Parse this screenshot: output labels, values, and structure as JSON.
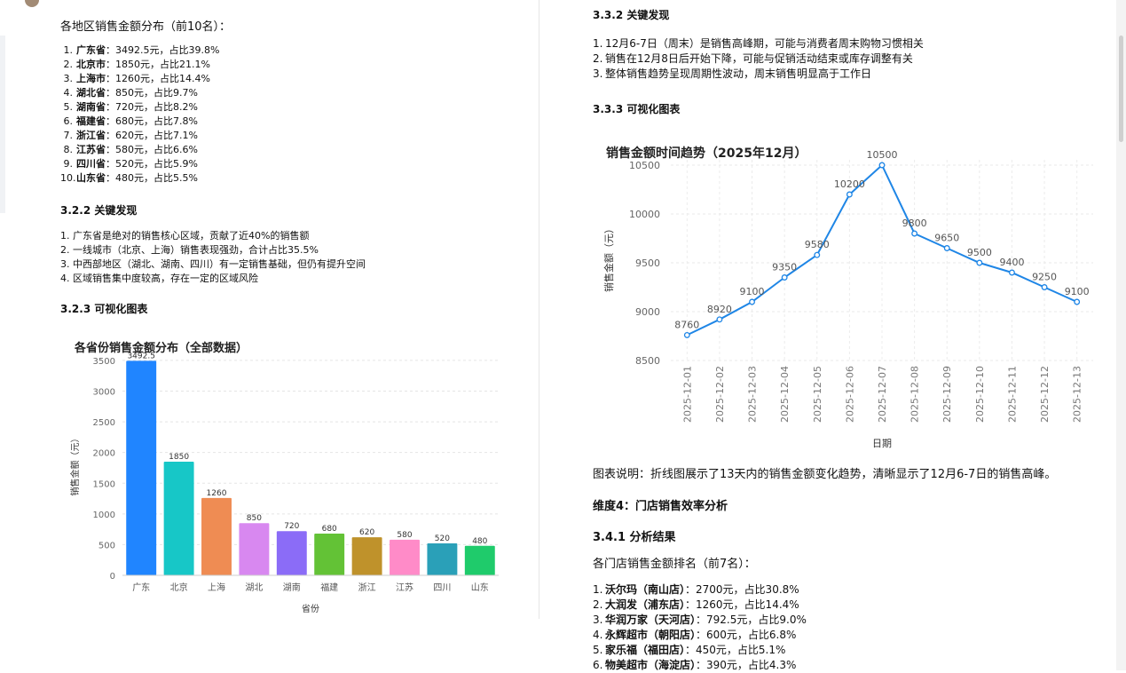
{
  "left": {
    "intro": "各地区销售金额分布（前10名）：",
    "region_list": [
      {
        "num": "1.",
        "name": "广东省",
        "detail": "：3492.5元，占比39.8%"
      },
      {
        "num": "2.",
        "name": "北京市",
        "detail": "：1850元，占比21.1%"
      },
      {
        "num": "3.",
        "name": "上海市",
        "detail": "：1260元，占比14.4%"
      },
      {
        "num": "4.",
        "name": "湖北省",
        "detail": "：850元，占比9.7%"
      },
      {
        "num": "5.",
        "name": "湖南省",
        "detail": "：720元，占比8.2%"
      },
      {
        "num": "6.",
        "name": "福建省",
        "detail": "：680元，占比7.8%"
      },
      {
        "num": "7.",
        "name": "浙江省",
        "detail": "：620元，占比7.1%"
      },
      {
        "num": "8.",
        "name": "江苏省",
        "detail": "：580元，占比6.6%"
      },
      {
        "num": "9.",
        "name": "四川省",
        "detail": "：520元，占比5.9%"
      },
      {
        "num": "10.",
        "name": "山东省",
        "detail": "：480元，占比5.5%"
      }
    ],
    "heading_findings": "3.2.2 关键发现",
    "findings": [
      {
        "num": "1.",
        "text": "广东省是绝对的销售核心区域，贡献了近40%的销售额"
      },
      {
        "num": "2.",
        "text": "一线城市（北京、上海）销售表现强劲，合计占比35.5%"
      },
      {
        "num": "3.",
        "text": "中西部地区（湖北、湖南、四川）有一定销售基础，但仍有提升空间"
      },
      {
        "num": "4.",
        "text": "区域销售集中度较高，存在一定的区域风险"
      }
    ],
    "heading_chart": "3.2.3 可视化图表"
  },
  "right": {
    "heading_findings": "3.3.2 关键发现",
    "findings": [
      {
        "num": "1.",
        "text": "12月6-7日（周末）是销售高峰期，可能与消费者周末购物习惯相关"
      },
      {
        "num": "2.",
        "text": "销售在12月8日后开始下降，可能与促销活动结束或库存调整有关"
      },
      {
        "num": "3.",
        "text": "整体销售趋势呈现周期性波动，周末销售明显高于工作日"
      }
    ],
    "heading_chart": "3.3.3 可视化图表",
    "chart_caption": "图表说明：折线图展示了13天内的销售金额变化趋势，清晰显示了12月6-7日的销售高峰。",
    "heading_dim4": "维度4：门店销售效率分析",
    "heading_341": "3.4.1 分析结果",
    "store_intro": "各门店销售金额排名（前7名）：",
    "store_list": [
      {
        "num": "1.",
        "name": "沃尔玛（南山店）",
        "detail": "：2700元，占比30.8%"
      },
      {
        "num": "2.",
        "name": "大润发（浦东店）",
        "detail": "：1260元，占比14.4%"
      },
      {
        "num": "3.",
        "name": "华润万家（天河店）",
        "detail": "：792.5元，占比9.0%"
      },
      {
        "num": "4.",
        "name": "永辉超市（朝阳店）",
        "detail": "：600元，占比6.8%"
      },
      {
        "num": "5.",
        "name": "家乐福（福田店）",
        "detail": "：450元，占比5.1%"
      },
      {
        "num": "6.",
        "name": "物美超市（海淀店）",
        "detail": "：390元，占比4.3%"
      }
    ]
  },
  "chart_data": [
    {
      "type": "bar",
      "title": "各省份销售金额分布（全部数据）",
      "xlabel": "省份",
      "ylabel": "销售金额（元）",
      "categories": [
        "广东",
        "北京",
        "上海",
        "湖北",
        "湖南",
        "福建",
        "浙江",
        "江苏",
        "四川",
        "山东"
      ],
      "values": [
        3492.5,
        1850,
        1260,
        850,
        720,
        680,
        620,
        580,
        520,
        480
      ],
      "value_labels": [
        "3492.5",
        "1850",
        "1260",
        "850",
        "720",
        "680",
        "620",
        "580",
        "520",
        "480"
      ],
      "colors": [
        "#2085ff",
        "#17c7c7",
        "#ef8c53",
        "#d888f0",
        "#8b6cf7",
        "#63c236",
        "#bf922b",
        "#ff8bc8",
        "#2aa0b8",
        "#1fcb6b"
      ],
      "ylim": [
        0,
        3600
      ],
      "yticks": [
        0,
        500,
        1000,
        1500,
        2000,
        2500,
        3000,
        3500
      ],
      "grid": true
    },
    {
      "type": "line",
      "title": "销售金额时间趋势（2025年12月）",
      "xlabel": "日期",
      "ylabel": "销售金额（元）",
      "x": [
        "2025-12-01",
        "2025-12-02",
        "2025-12-03",
        "2025-12-04",
        "2025-12-05",
        "2025-12-06",
        "2025-12-07",
        "2025-12-08",
        "2025-12-09",
        "2025-12-10",
        "2025-12-11",
        "2025-12-12",
        "2025-12-13"
      ],
      "values": [
        8760,
        8920,
        9100,
        9350,
        9580,
        10200,
        10500,
        9800,
        9650,
        9500,
        9400,
        9250,
        9100
      ],
      "ylim": [
        8500,
        10600
      ],
      "yticks": [
        8500,
        9000,
        9500,
        10000,
        10500
      ],
      "color": "#1f86e6",
      "grid": true
    }
  ]
}
